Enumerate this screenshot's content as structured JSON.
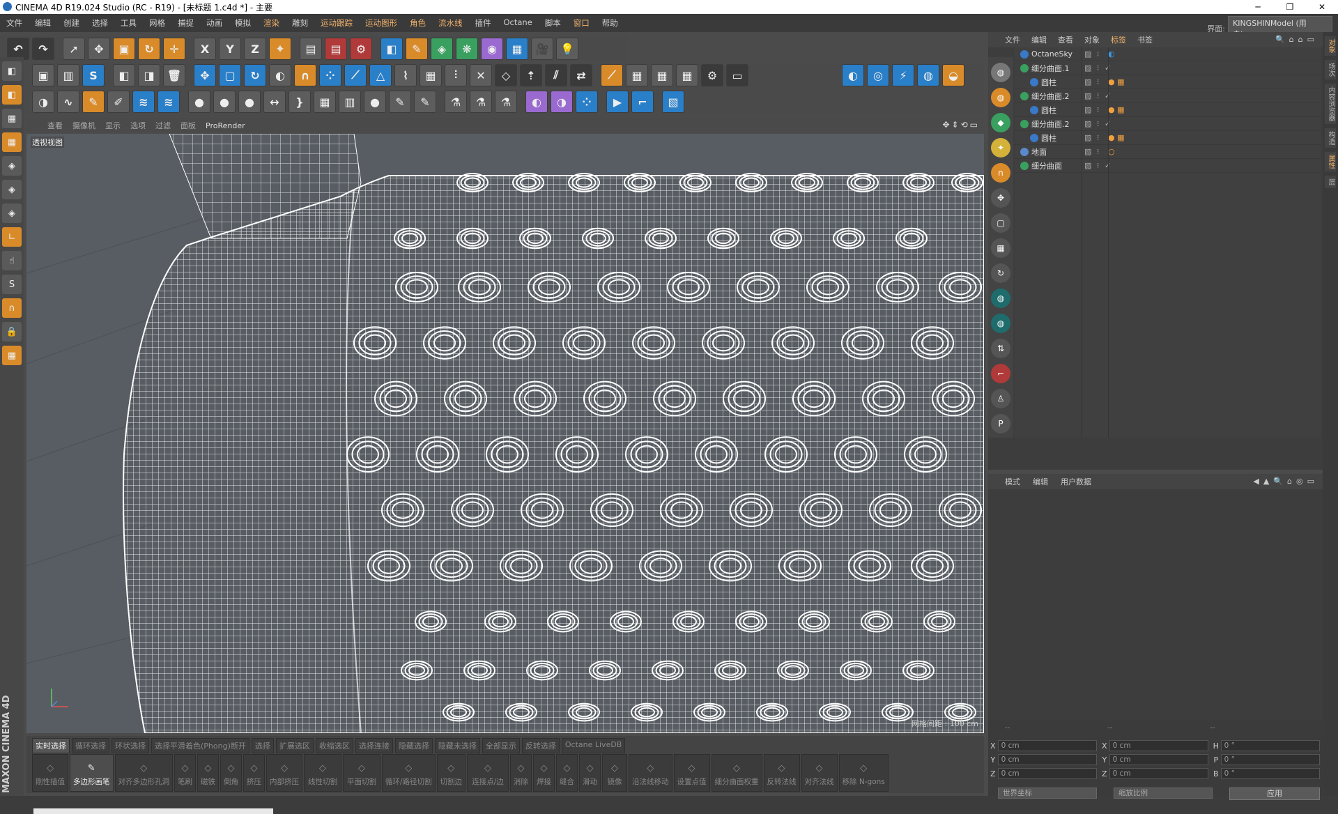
{
  "window": {
    "title": "CINEMA 4D R19.024 Studio (RC - R19) - [未标题 1.c4d *] - 主要",
    "minimize": "─",
    "restore": "❐",
    "close": "✕"
  },
  "menu": {
    "items": [
      "文件",
      "编辑",
      "创建",
      "选择",
      "工具",
      "网格",
      "捕捉",
      "动画",
      "模拟",
      "渲染",
      "雕刻",
      "运动跟踪",
      "运动图形",
      "角色",
      "流水线",
      "插件",
      "Octane",
      "脚本",
      "窗口",
      "帮助"
    ],
    "highlighted": [
      "渲染",
      "运动跟踪",
      "运动图形",
      "角色",
      "流水线",
      "窗口"
    ],
    "interface_label": "界面:",
    "interface_value": "KINGSHINModel (用户)"
  },
  "viewport": {
    "menu": [
      "查看",
      "摄像机",
      "显示",
      "选项",
      "过滤",
      "面板",
      "ProRender"
    ],
    "label": "透视视图",
    "grid_info": "网格间距 : 100 cm",
    "accent_bg": "#585d63",
    "wire_color": "#ffffff"
  },
  "brand": "MAXON CINEMA 4D",
  "selection_row": [
    "实时选择",
    "循环选择",
    "环状选择",
    "选择平滑着色(Phong)断开",
    "选择",
    "扩展选区",
    "收缩选区",
    "选择连接",
    "隐藏选择",
    "隐藏未选择",
    "全部显示",
    "反转选择",
    "Octane LiveDB"
  ],
  "tool_row": [
    "刚性插值",
    "多边形画笔",
    "对齐多边形孔洞",
    "笔刷",
    "磁铁",
    "倒角",
    "挤压",
    "内部挤压",
    "线性切割",
    "平面切割",
    "循环/路径切割",
    "切割边",
    "连接点/边",
    "消除",
    "焊接",
    "缝合",
    "滑动",
    "镜像",
    "沿法线移动",
    "设置点值",
    "细分曲面权重",
    "反转法线",
    "对齐法线",
    "移除 N-gons"
  ],
  "object_manager": {
    "menu": [
      "文件",
      "编辑",
      "查看",
      "对象",
      "标签",
      "书签"
    ],
    "objects": [
      {
        "name": "OctaneSky",
        "indent": 0,
        "icon": "sky-icon",
        "tag": "◐"
      },
      {
        "name": "细分曲面.1",
        "indent": 0,
        "icon": "subdivision-icon",
        "tag": ""
      },
      {
        "name": "圆柱",
        "indent": 1,
        "icon": "cylinder-icon",
        "tag": "● ▦"
      },
      {
        "name": "细分曲面.2",
        "indent": 0,
        "icon": "subdivision-icon",
        "tag": ""
      },
      {
        "name": "圆柱",
        "indent": 1,
        "icon": "cylinder-icon",
        "tag": "● ▦"
      },
      {
        "name": "细分曲面.2",
        "indent": 0,
        "icon": "subdivision-icon",
        "tag": ""
      },
      {
        "name": "圆柱",
        "indent": 1,
        "icon": "cylinder-icon",
        "tag": "● ▦"
      },
      {
        "name": "地面",
        "indent": 0,
        "icon": "floor-icon",
        "tag": "○"
      },
      {
        "name": "细分曲面",
        "indent": 0,
        "icon": "subdivision-icon",
        "tag": ""
      }
    ]
  },
  "attribute_manager": {
    "menu": [
      "模式",
      "编辑",
      "用户数据"
    ]
  },
  "coordinates": {
    "dashes": [
      "--",
      "--",
      "--"
    ],
    "rows": [
      {
        "a": "X",
        "av": "0 cm",
        "b": "X",
        "bv": "0 cm",
        "c": "H",
        "cv": "0 °"
      },
      {
        "a": "Y",
        "av": "0 cm",
        "b": "Y",
        "bv": "0 cm",
        "c": "P",
        "cv": "0 °"
      },
      {
        "a": "Z",
        "av": "0 cm",
        "b": "Z",
        "bv": "0 cm",
        "c": "B",
        "cv": "0 °"
      }
    ],
    "world": "世界坐标",
    "scale": "缩放比例",
    "apply": "应用"
  },
  "right_strip": [
    "对象",
    "场次",
    "内容浏览器",
    "构造",
    "属性",
    "层"
  ]
}
